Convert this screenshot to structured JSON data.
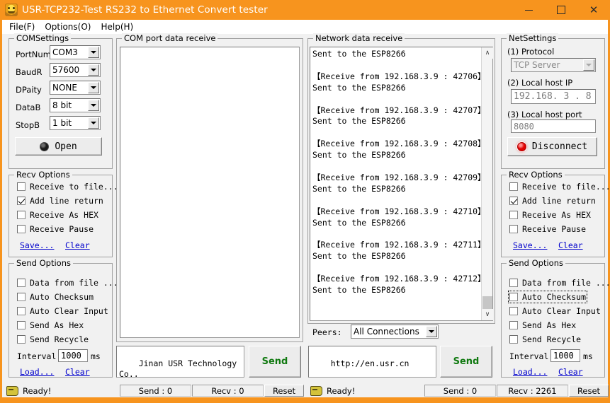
{
  "window": {
    "title": "USR-TCP232-Test  RS232 to Ethernet Convert tester",
    "icon": "app-icon",
    "minimize": "–",
    "maximize": "□",
    "close": "✕",
    "accent_color": "#f7941e"
  },
  "menu": [
    {
      "label": "File(F)"
    },
    {
      "label": "Options(O)"
    },
    {
      "label": "Help(H)"
    }
  ],
  "com_settings": {
    "legend": "COMSettings",
    "rows": [
      {
        "label": "PortNum",
        "value": "COM3"
      },
      {
        "label": "BaudR",
        "value": "57600"
      },
      {
        "label": "DPaity",
        "value": "NONE"
      },
      {
        "label": "DataB",
        "value": "8 bit"
      },
      {
        "label": "StopB",
        "value": "1 bit"
      }
    ],
    "open_button": "Open",
    "open_led_color": "#1a1a1a"
  },
  "left_recv_options": {
    "legend": "Recv Options",
    "items": [
      {
        "label": "Receive to file...",
        "checked": false
      },
      {
        "label": "Add line return",
        "checked": true
      },
      {
        "label": "Receive As HEX",
        "checked": false
      },
      {
        "label": "Receive Pause",
        "checked": false
      }
    ],
    "save_link": "Save...",
    "clear_link": "Clear"
  },
  "left_send_options": {
    "legend": "Send Options",
    "items": [
      {
        "label": "Data from file ....",
        "checked": false
      },
      {
        "label": "Auto Checksum",
        "checked": false
      },
      {
        "label": "Auto Clear Input",
        "checked": false
      },
      {
        "label": "Send As Hex",
        "checked": false
      },
      {
        "label": "Send Recycle",
        "checked": false
      }
    ],
    "interval_label": "Interval",
    "interval_value": "1000",
    "interval_unit": "ms",
    "load_link": "Load...",
    "clear_link": "Clear"
  },
  "com_receive": {
    "legend": "COM port data receive",
    "text": ""
  },
  "com_send": {
    "text": "Jinan USR Technology Co.,\nLtd.",
    "button": "Send"
  },
  "com_status": {
    "ready": "Ready!",
    "send": "Send : 0",
    "recv": "Recv : 0",
    "reset": "Reset"
  },
  "net_receive": {
    "legend": "Network data receive",
    "text": "Sent to the ESP8266\n\n【Receive from 192.168.3.9 : 42706】:\nSent to the ESP8266\n\n【Receive from 192.168.3.9 : 42707】:\nSent to the ESP8266\n\n【Receive from 192.168.3.9 : 42708】:\nSent to the ESP8266\n\n【Receive from 192.168.3.9 : 42709】:\nSent to the ESP8266\n\n【Receive from 192.168.3.9 : 42710】:\nSent to the ESP8266\n\n【Receive from 192.168.3.9 : 42711】:\nSent to the ESP8266\n\n【Receive from 192.168.3.9 : 42712】:\nSent to the ESP8266",
    "scroll_up": "∧",
    "scroll_down": "∨"
  },
  "peers": {
    "label": "Peers:",
    "value": "All Connections"
  },
  "net_send": {
    "text": "http://en.usr.cn",
    "button": "Send"
  },
  "net_status": {
    "ready": "Ready!",
    "send": "Send : 0",
    "recv": "Recv : 2261",
    "reset": "Reset"
  },
  "net_settings": {
    "legend": "NetSettings",
    "protocol_label": "(1) Protocol",
    "protocol_value": "TCP Server",
    "local_ip_label": "(2) Local host IP",
    "local_ip_value": "192.168. 3 . 8",
    "local_port_label": "(3) Local host port",
    "local_port_value": "8080",
    "disconnect_button": "Disconnect",
    "disconnect_led_color": "#e00000"
  },
  "right_recv_options": {
    "legend": "Recv Options",
    "items": [
      {
        "label": "Receive to file...",
        "checked": false
      },
      {
        "label": "Add line return",
        "checked": true
      },
      {
        "label": "Receive As HEX",
        "checked": false
      },
      {
        "label": "Receive Pause",
        "checked": false
      }
    ],
    "save_link": "Save...",
    "clear_link": "Clear"
  },
  "right_send_options": {
    "legend": "Send Options",
    "items": [
      {
        "label": "Data from file ....",
        "checked": false
      },
      {
        "label": "Auto Checksum",
        "checked": false,
        "focused": true
      },
      {
        "label": "Auto Clear Input",
        "checked": false
      },
      {
        "label": "Send As Hex",
        "checked": false
      },
      {
        "label": "Send Recycle",
        "checked": false
      }
    ],
    "interval_label": "Interval",
    "interval_value": "1000",
    "interval_unit": "ms",
    "load_link": "Load...",
    "clear_link": "Clear"
  }
}
